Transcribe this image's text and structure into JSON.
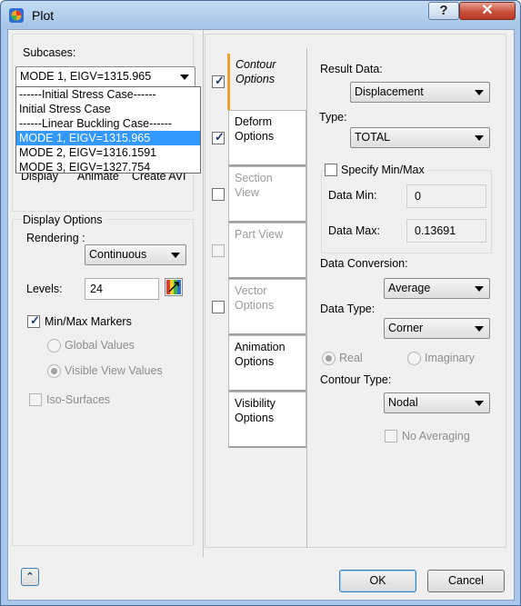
{
  "window": {
    "title": "Plot",
    "help_label": "?",
    "close_label": "✕"
  },
  "left": {
    "subcases_label": "Subcases:",
    "subcase_value": "MODE 1, EIGV=1315.965",
    "dropdown_options": [
      "------Initial Stress Case------",
      "Initial Stress Case",
      "------Linear Buckling Case------",
      "MODE 1, EIGV=1315.965",
      "MODE 2, EIGV=1316.1591",
      "MODE 3, EIGV=1327.754"
    ],
    "behind_labels": [
      "Display",
      "Animate",
      "Create AVI"
    ],
    "display_options_label": "Display Options",
    "rendering_label": "Rendering :",
    "rendering_value": "Continuous",
    "levels_label": "Levels:",
    "levels_value": "24",
    "minmax_markers_label": "Min/Max Markers",
    "global_values_label": "Global Values",
    "visible_view_values_label": "Visible View Values",
    "iso_surfaces_label": "Iso-Surfaces"
  },
  "tabs": [
    {
      "label": "Contour Options",
      "checked": true
    },
    {
      "label": "Deform Options",
      "checked": true
    },
    {
      "label": "Section View",
      "checked": false
    },
    {
      "label": "Part View",
      "checked": false
    },
    {
      "label": "Vector Options",
      "checked": false
    },
    {
      "label": "Animation Options"
    },
    {
      "label": "Visibility Options"
    }
  ],
  "contour": {
    "result_data_label": "Result Data:",
    "result_data_value": "Displacement",
    "type_label": "Type:",
    "type_value": "TOTAL",
    "specify_minmax_label": "Specify Min/Max",
    "data_min_label": "Data Min:",
    "data_min_value": "0",
    "data_max_label": "Data Max:",
    "data_max_value": "0.13691",
    "data_conversion_label": "Data Conversion:",
    "data_conversion_value": "Average",
    "data_type_label": "Data Type:",
    "data_type_value": "Corner",
    "real_label": "Real",
    "imaginary_label": "Imaginary",
    "contour_type_label": "Contour Type:",
    "contour_type_value": "Nodal",
    "no_averaging_label": "No Averaging"
  },
  "footer": {
    "ok_label": "OK",
    "cancel_label": "Cancel",
    "expand_label": "⌃"
  },
  "colors": {
    "accent_tab": "#f0a030",
    "selection": "#3399ff",
    "window_frame": "#a9c7ea"
  }
}
